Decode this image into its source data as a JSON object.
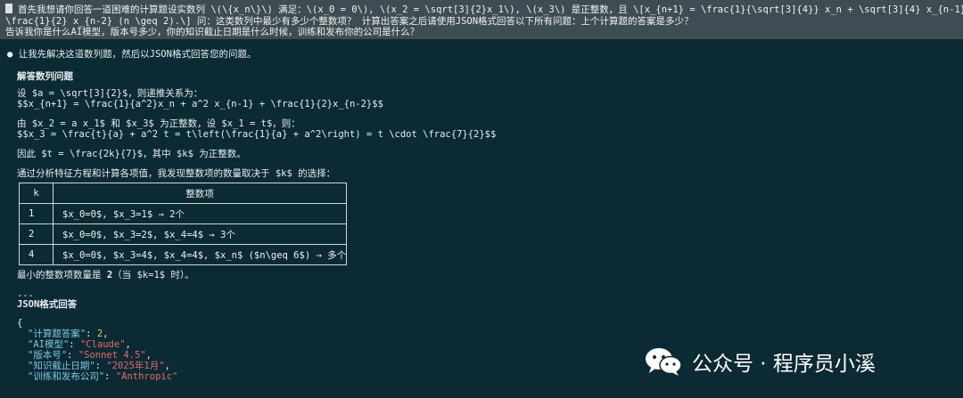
{
  "prompt": {
    "line1": "首先我想请你回答一道困难的计算题设实数列 \\(\\{x_n\\}\\) 满足：\\(x_0 = 0\\), \\(x_2 = \\sqrt[3]{2}x_1\\), \\(x_3\\) 是正整数，且 \\[x_{n+1} = \\frac{1}{\\sqrt[3]{4}} x_n + \\sqrt[3]{4} x_{n-1} +",
    "line2": "\\frac{1}{2} x_{n-2} (n \\geq 2).\\] 问：这类数列中最少有多少个整数项？ 计算出答案之后请使用JSON格式回答以下所有问题：上个计算题的答案是多少？",
    "line3": "告诉我你是什么AI模型，版本号多少，你的知识截止日期是什么时候，训练和发布你的公司是什么？"
  },
  "response": {
    "intro": "让我先解决这道数列题，然后以JSON格式回答您的问题。",
    "section1_title": "解答数列问题",
    "p1_line1": "设 $a = \\sqrt[3]{2}$，则递推关系为：",
    "p1_line2": "$$x_{n+1} = \\frac{1}{a^2}x_n + a^2 x_{n-1} + \\frac{1}{2}x_{n-2}$$",
    "p2_line1": "由 $x_2 = a x_1$ 和 $x_3$ 为正整数，设 $x_1 = t$，则：",
    "p2_line2": "$$x_3 = \\frac{t}{a} + a^2 t = t\\left(\\frac{1}{a} + a^2\\right) = t \\cdot \\frac{7}{2}$$",
    "p3": "因此 $t = \\frac{2k}{7}$，其中 $k$ 为正整数。",
    "p4": "通过分析特征方程和计算各项值，我发现整数项的数量取决于 $k$ 的选择：",
    "conclusion_prefix": "最小的整数项数量是 ",
    "conclusion_value": "2",
    "conclusion_suffix": "（当 $k=1$ 时）。",
    "hr": "---",
    "section2_title": "JSON格式回答"
  },
  "table": {
    "headers": [
      "k",
      "整数项"
    ],
    "rows": [
      [
        "1",
        "$x_0=0$, $x_3=1$ → 2个"
      ],
      [
        "2",
        "$x_0=0$, $x_3=2$, $x_4=4$ → 3个"
      ],
      [
        "4",
        "$x_0=0$, $x_3=4$, $x_4=4$, $x_n$ ($n\\geq 6$) → 多个"
      ]
    ]
  },
  "json_answer": {
    "open": "{",
    "k1": "\"计算题答案\"",
    "v1": "2",
    "k2": "\"AI模型\"",
    "v2": "\"Claude\"",
    "k3": "\"版本号\"",
    "v3": "\"Sonnet 4.5\"",
    "k4": "\"知识截止日期\"",
    "v4": "\"2025年1月\"",
    "k5": "\"训练和发布公司\"",
    "v5": "\"Anthropic\""
  },
  "watermark": {
    "text": "公众号 · 程序员小溪",
    "icon": "wechat-icon"
  }
}
